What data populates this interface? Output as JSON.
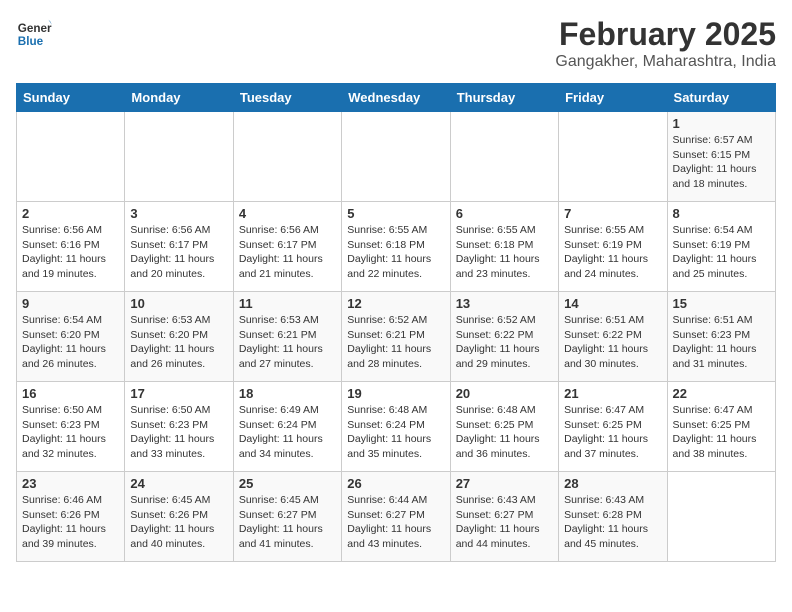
{
  "header": {
    "logo_line1": "General",
    "logo_line2": "Blue",
    "title": "February 2025",
    "subtitle": "Gangakher, Maharashtra, India"
  },
  "weekdays": [
    "Sunday",
    "Monday",
    "Tuesday",
    "Wednesday",
    "Thursday",
    "Friday",
    "Saturday"
  ],
  "weeks": [
    [
      {
        "day": "",
        "info": ""
      },
      {
        "day": "",
        "info": ""
      },
      {
        "day": "",
        "info": ""
      },
      {
        "day": "",
        "info": ""
      },
      {
        "day": "",
        "info": ""
      },
      {
        "day": "",
        "info": ""
      },
      {
        "day": "1",
        "info": "Sunrise: 6:57 AM\nSunset: 6:15 PM\nDaylight: 11 hours and 18 minutes."
      }
    ],
    [
      {
        "day": "2",
        "info": "Sunrise: 6:56 AM\nSunset: 6:16 PM\nDaylight: 11 hours and 19 minutes."
      },
      {
        "day": "3",
        "info": "Sunrise: 6:56 AM\nSunset: 6:17 PM\nDaylight: 11 hours and 20 minutes."
      },
      {
        "day": "4",
        "info": "Sunrise: 6:56 AM\nSunset: 6:17 PM\nDaylight: 11 hours and 21 minutes."
      },
      {
        "day": "5",
        "info": "Sunrise: 6:55 AM\nSunset: 6:18 PM\nDaylight: 11 hours and 22 minutes."
      },
      {
        "day": "6",
        "info": "Sunrise: 6:55 AM\nSunset: 6:18 PM\nDaylight: 11 hours and 23 minutes."
      },
      {
        "day": "7",
        "info": "Sunrise: 6:55 AM\nSunset: 6:19 PM\nDaylight: 11 hours and 24 minutes."
      },
      {
        "day": "8",
        "info": "Sunrise: 6:54 AM\nSunset: 6:19 PM\nDaylight: 11 hours and 25 minutes."
      }
    ],
    [
      {
        "day": "9",
        "info": "Sunrise: 6:54 AM\nSunset: 6:20 PM\nDaylight: 11 hours and 26 minutes."
      },
      {
        "day": "10",
        "info": "Sunrise: 6:53 AM\nSunset: 6:20 PM\nDaylight: 11 hours and 26 minutes."
      },
      {
        "day": "11",
        "info": "Sunrise: 6:53 AM\nSunset: 6:21 PM\nDaylight: 11 hours and 27 minutes."
      },
      {
        "day": "12",
        "info": "Sunrise: 6:52 AM\nSunset: 6:21 PM\nDaylight: 11 hours and 28 minutes."
      },
      {
        "day": "13",
        "info": "Sunrise: 6:52 AM\nSunset: 6:22 PM\nDaylight: 11 hours and 29 minutes."
      },
      {
        "day": "14",
        "info": "Sunrise: 6:51 AM\nSunset: 6:22 PM\nDaylight: 11 hours and 30 minutes."
      },
      {
        "day": "15",
        "info": "Sunrise: 6:51 AM\nSunset: 6:23 PM\nDaylight: 11 hours and 31 minutes."
      }
    ],
    [
      {
        "day": "16",
        "info": "Sunrise: 6:50 AM\nSunset: 6:23 PM\nDaylight: 11 hours and 32 minutes."
      },
      {
        "day": "17",
        "info": "Sunrise: 6:50 AM\nSunset: 6:23 PM\nDaylight: 11 hours and 33 minutes."
      },
      {
        "day": "18",
        "info": "Sunrise: 6:49 AM\nSunset: 6:24 PM\nDaylight: 11 hours and 34 minutes."
      },
      {
        "day": "19",
        "info": "Sunrise: 6:48 AM\nSunset: 6:24 PM\nDaylight: 11 hours and 35 minutes."
      },
      {
        "day": "20",
        "info": "Sunrise: 6:48 AM\nSunset: 6:25 PM\nDaylight: 11 hours and 36 minutes."
      },
      {
        "day": "21",
        "info": "Sunrise: 6:47 AM\nSunset: 6:25 PM\nDaylight: 11 hours and 37 minutes."
      },
      {
        "day": "22",
        "info": "Sunrise: 6:47 AM\nSunset: 6:25 PM\nDaylight: 11 hours and 38 minutes."
      }
    ],
    [
      {
        "day": "23",
        "info": "Sunrise: 6:46 AM\nSunset: 6:26 PM\nDaylight: 11 hours and 39 minutes."
      },
      {
        "day": "24",
        "info": "Sunrise: 6:45 AM\nSunset: 6:26 PM\nDaylight: 11 hours and 40 minutes."
      },
      {
        "day": "25",
        "info": "Sunrise: 6:45 AM\nSunset: 6:27 PM\nDaylight: 11 hours and 41 minutes."
      },
      {
        "day": "26",
        "info": "Sunrise: 6:44 AM\nSunset: 6:27 PM\nDaylight: 11 hours and 43 minutes."
      },
      {
        "day": "27",
        "info": "Sunrise: 6:43 AM\nSunset: 6:27 PM\nDaylight: 11 hours and 44 minutes."
      },
      {
        "day": "28",
        "info": "Sunrise: 6:43 AM\nSunset: 6:28 PM\nDaylight: 11 hours and 45 minutes."
      },
      {
        "day": "",
        "info": ""
      }
    ]
  ]
}
